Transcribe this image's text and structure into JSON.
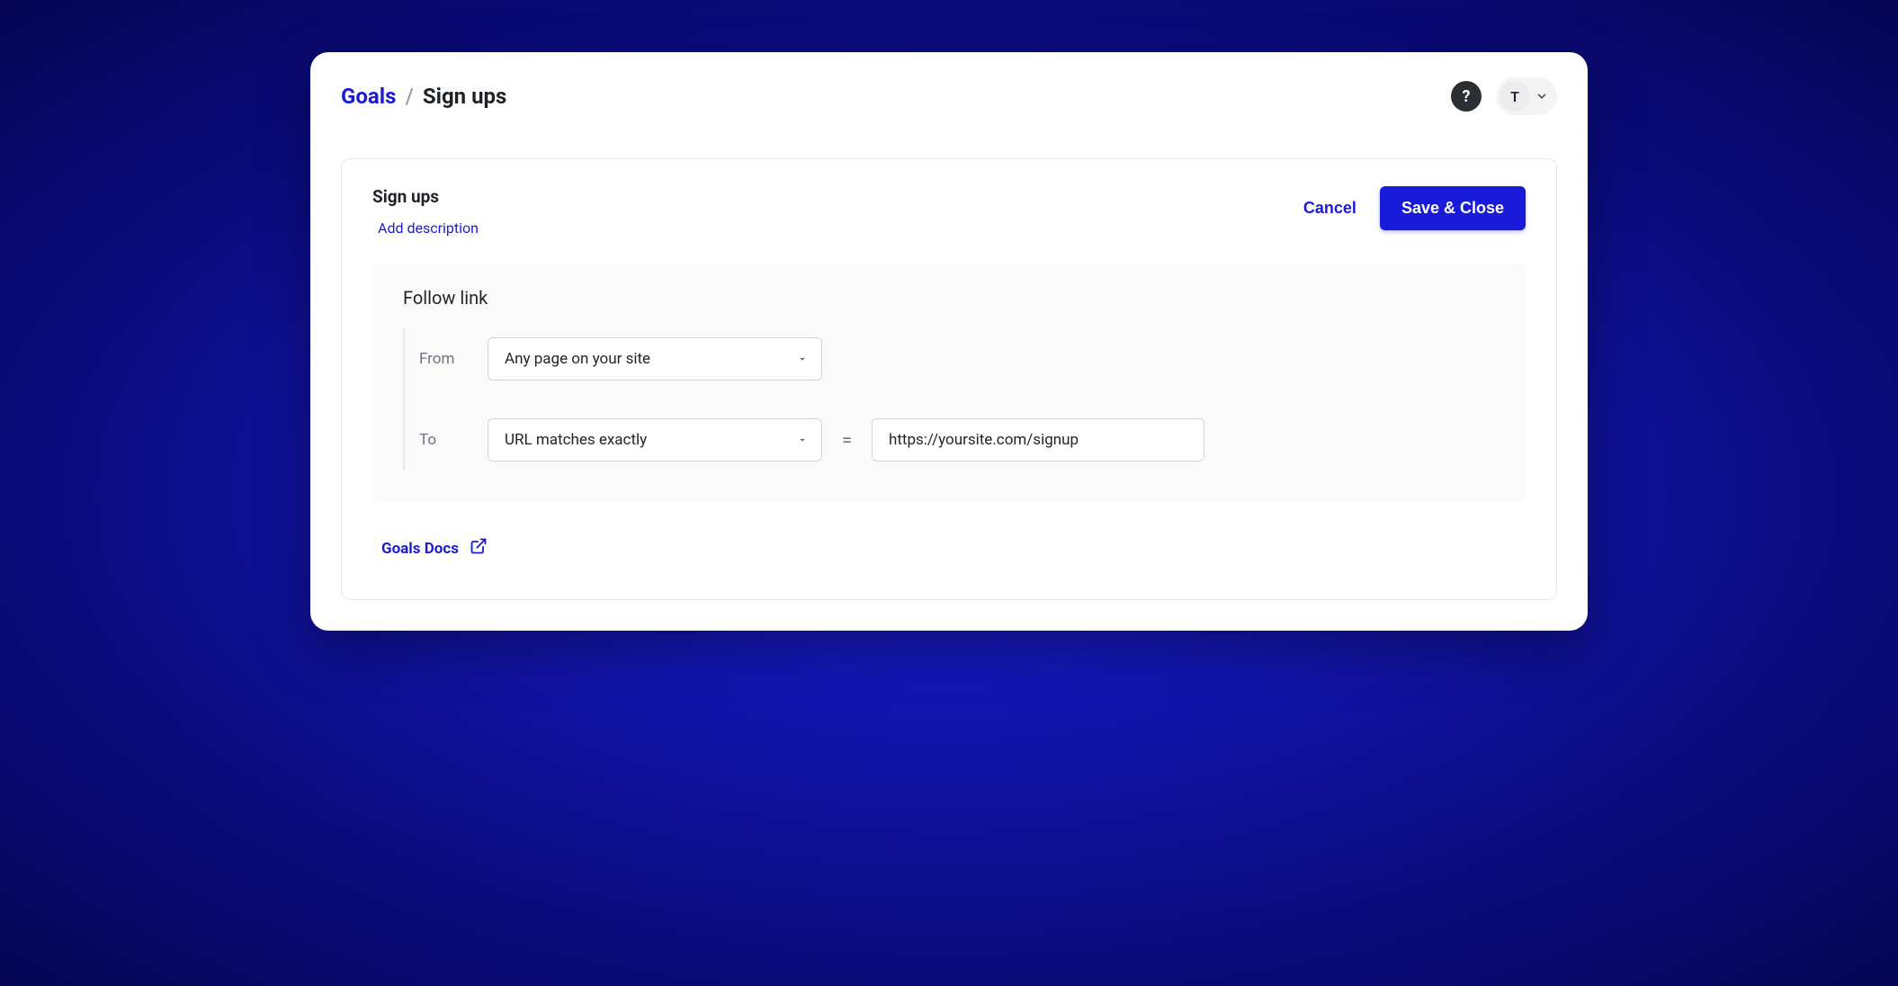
{
  "breadcrumb": {
    "root": "Goals",
    "separator": "/",
    "current": "Sign ups"
  },
  "topbar": {
    "help_label": "?",
    "avatar_initial": "T"
  },
  "panel": {
    "goal_name": "Sign ups",
    "add_description_label": "Add description",
    "cancel_label": "Cancel",
    "save_label": "Save & Close"
  },
  "rule": {
    "title": "Follow link",
    "from_label": "From",
    "from_value": "Any page on your site",
    "to_label": "To",
    "to_match_value": "URL matches exactly",
    "equals": "=",
    "to_url_value": "https://yoursite.com/signup"
  },
  "footer": {
    "docs_label": "Goals Docs"
  }
}
